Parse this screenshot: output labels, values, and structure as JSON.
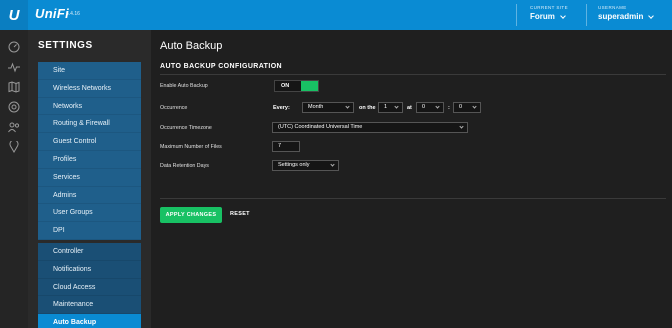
{
  "app": {
    "logo": "U",
    "brand": "UniFi",
    "version": "5.4.16"
  },
  "header": {
    "site_label": "CURRENT SITE",
    "site_value": "Forum",
    "user_label": "USERNAME",
    "user_value": "superadmin",
    "accent_color": "#0a8bd3"
  },
  "rail_icons": [
    "dashboard-icon",
    "statistics-icon",
    "map-icon",
    "devices-icon",
    "clients-icon",
    "insights-icon"
  ],
  "sidebar": {
    "title": "SETTINGS",
    "items": [
      {
        "label": "Site"
      },
      {
        "label": "Wireless Networks"
      },
      {
        "label": "Networks"
      },
      {
        "label": "Routing & Firewall"
      },
      {
        "label": "Guest Control"
      },
      {
        "label": "Profiles"
      },
      {
        "label": "Services"
      },
      {
        "label": "Admins"
      },
      {
        "label": "User Groups"
      },
      {
        "label": "DPI"
      },
      {
        "label": "Controller"
      },
      {
        "label": "Notifications"
      },
      {
        "label": "Cloud Access"
      },
      {
        "label": "Maintenance"
      },
      {
        "label": "Auto Backup"
      }
    ],
    "active": "Auto Backup"
  },
  "main": {
    "title": "Auto Backup",
    "section": "AUTO BACKUP CONFIGURATION",
    "enable": {
      "label": "Enable Auto Backup",
      "value": "ON"
    },
    "occurrence": {
      "label": "Occurrence",
      "every_label": "Every:",
      "period": "Month",
      "on_the_label": "on the",
      "day": "1",
      "at_label": "at",
      "hour": "0",
      "colon": ":",
      "minute": "0"
    },
    "timezone": {
      "label": "Occurrence Timezone",
      "value": "(UTC) Coordinated Universal Time"
    },
    "max_files": {
      "label": "Maximum Number of Files",
      "value": "7"
    },
    "retention": {
      "label": "Data Retention Days",
      "value": "Settings only"
    },
    "apply_label": "APPLY CHANGES",
    "reset_label": "RESET",
    "apply_color": "#18c164"
  }
}
